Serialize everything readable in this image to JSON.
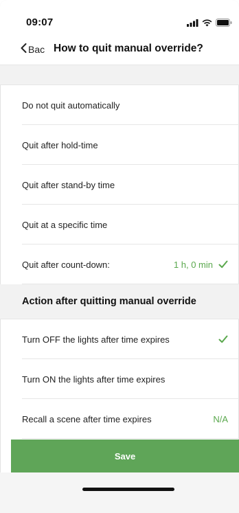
{
  "status_bar": {
    "time": "09:07"
  },
  "nav": {
    "back_label": "Back",
    "title": "How to quit manual override?"
  },
  "quit_options": [
    {
      "label": "Do not quit automatically",
      "value": "",
      "selected": false
    },
    {
      "label": "Quit after hold-time",
      "value": "",
      "selected": false
    },
    {
      "label": "Quit after stand-by time",
      "value": "",
      "selected": false
    },
    {
      "label": "Quit at a specific time",
      "value": "",
      "selected": false
    },
    {
      "label": "Quit after count-down:",
      "value": "1 h, 0 min",
      "selected": true
    }
  ],
  "action_section": {
    "title": "Action after quitting manual override",
    "options": [
      {
        "label": "Turn OFF the lights after time expires",
        "value": "",
        "selected": true
      },
      {
        "label": "Turn ON the lights after time expires",
        "value": "",
        "selected": false
      },
      {
        "label": "Recall a scene after time expires",
        "value": "N/A",
        "selected": false
      }
    ]
  },
  "footer": {
    "save_label": "Save"
  },
  "colors": {
    "accent_green": "#5fa558",
    "value_green": "#5aa84d",
    "section_gray": "#f2f2f2"
  }
}
